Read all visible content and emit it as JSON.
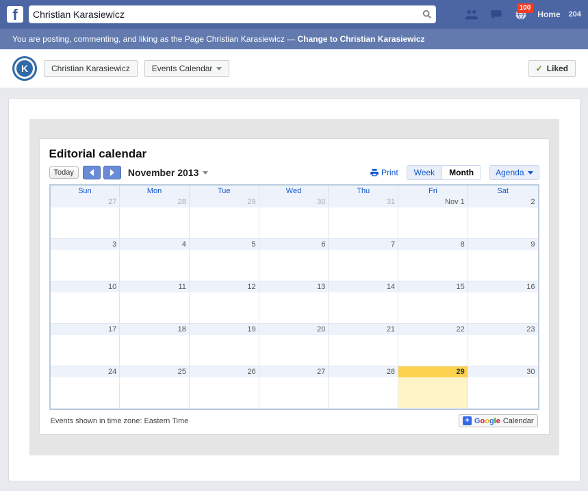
{
  "nav": {
    "search_value": "Christian Karasiewicz",
    "notification_count": "100",
    "home_label": "Home",
    "right_count": "204"
  },
  "voice_bar": {
    "prefix": "You are posting, commenting, and liking as the Page Christian Karasiewicz — ",
    "link": "Change to Christian Karasiewicz"
  },
  "page_header": {
    "page_name": "Christian Karasiewicz",
    "tab_name": "Events Calendar",
    "liked_label": "Liked",
    "avatar_initial": "K"
  },
  "calendar": {
    "title": "Editorial calendar",
    "today_label": "Today",
    "month_label": "November 2013",
    "print_label": "Print",
    "views": {
      "week": "Week",
      "month": "Month",
      "agenda": "Agenda"
    },
    "dow": [
      "Sun",
      "Mon",
      "Tue",
      "Wed",
      "Thu",
      "Fri",
      "Sat"
    ],
    "weeks": [
      [
        {
          "d": "27",
          "other": true
        },
        {
          "d": "28",
          "other": true
        },
        {
          "d": "29",
          "other": true
        },
        {
          "d": "30",
          "other": true
        },
        {
          "d": "31",
          "other": true
        },
        {
          "d": "Nov 1"
        },
        {
          "d": "2"
        }
      ],
      [
        {
          "d": "3"
        },
        {
          "d": "4"
        },
        {
          "d": "5"
        },
        {
          "d": "6"
        },
        {
          "d": "7"
        },
        {
          "d": "8"
        },
        {
          "d": "9"
        }
      ],
      [
        {
          "d": "10"
        },
        {
          "d": "11"
        },
        {
          "d": "12"
        },
        {
          "d": "13"
        },
        {
          "d": "14"
        },
        {
          "d": "15"
        },
        {
          "d": "16"
        }
      ],
      [
        {
          "d": "17"
        },
        {
          "d": "18"
        },
        {
          "d": "19"
        },
        {
          "d": "20"
        },
        {
          "d": "21"
        },
        {
          "d": "22"
        },
        {
          "d": "23"
        }
      ],
      [
        {
          "d": "24"
        },
        {
          "d": "25"
        },
        {
          "d": "26"
        },
        {
          "d": "27"
        },
        {
          "d": "28"
        },
        {
          "d": "29",
          "today": true
        },
        {
          "d": "30"
        }
      ]
    ],
    "timezone_text": "Events shown in time zone: Eastern Time",
    "gcal_button": {
      "word": "Calendar"
    }
  }
}
